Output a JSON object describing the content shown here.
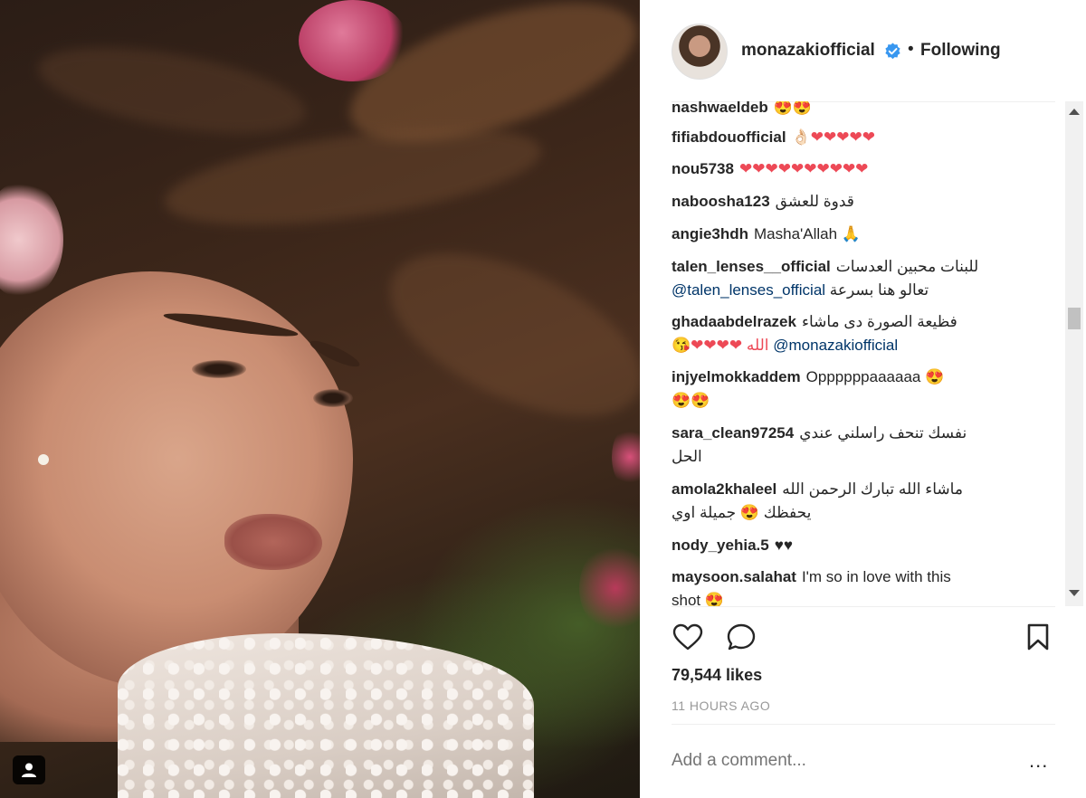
{
  "post": {
    "author": "monazakiofficial",
    "follow_separator": "•",
    "follow_status": "Following",
    "likes": "79,544 likes",
    "time_ago": "11 HOURS AGO",
    "comment_placeholder": "Add a comment...",
    "more_label": "..."
  },
  "comments": [
    {
      "user": "nashwaeldeb",
      "text": "😍😍"
    },
    {
      "user": "fifiabdouofficial",
      "text": "👌🏻❤❤❤❤❤"
    },
    {
      "user": "nou5738",
      "text": "❤❤❤❤❤❤❤❤❤❤"
    },
    {
      "user": "naboosha123",
      "text": "قدوة للعشق"
    },
    {
      "user": "angie3hdh",
      "text": "Masha'Allah 🙏"
    },
    {
      "user": "talen_lenses__official",
      "text": "للبنات محبين العدسات",
      "mention": "@talen_lenses_official",
      "text2": "تعالو هنا بسرعة"
    },
    {
      "user": "ghadaabdelrazek",
      "text": "فظيعة الصورة دى ماشاء",
      "mention": "@monazakiofficial",
      "text2": "😘❤❤❤❤ الله"
    },
    {
      "user": "injyelmokkaddem",
      "text": "Oppppppaaaaaa 😍",
      "text2": "😍😍"
    },
    {
      "user": "sara_clean97254",
      "text": "نفسك تنحف راسلني عندي",
      "text2": "الحل"
    },
    {
      "user": "amola2khaleel",
      "text": "ماشاء الله تبارك الرحمن الله",
      "text2": "يحفظك 😍 جميلة اوي"
    },
    {
      "user": "nody_yehia.5",
      "text": "♥♥"
    },
    {
      "user": "maysoon.salahat",
      "text": "I'm so in love with this",
      "text2": "shot 😍"
    }
  ],
  "colors": {
    "verified": "#3897f0",
    "mention": "#003569",
    "heart": "#ed4956"
  },
  "icons": [
    "heart-icon",
    "comment-icon",
    "bookmark-icon",
    "verified-icon",
    "user-tag-icon"
  ]
}
